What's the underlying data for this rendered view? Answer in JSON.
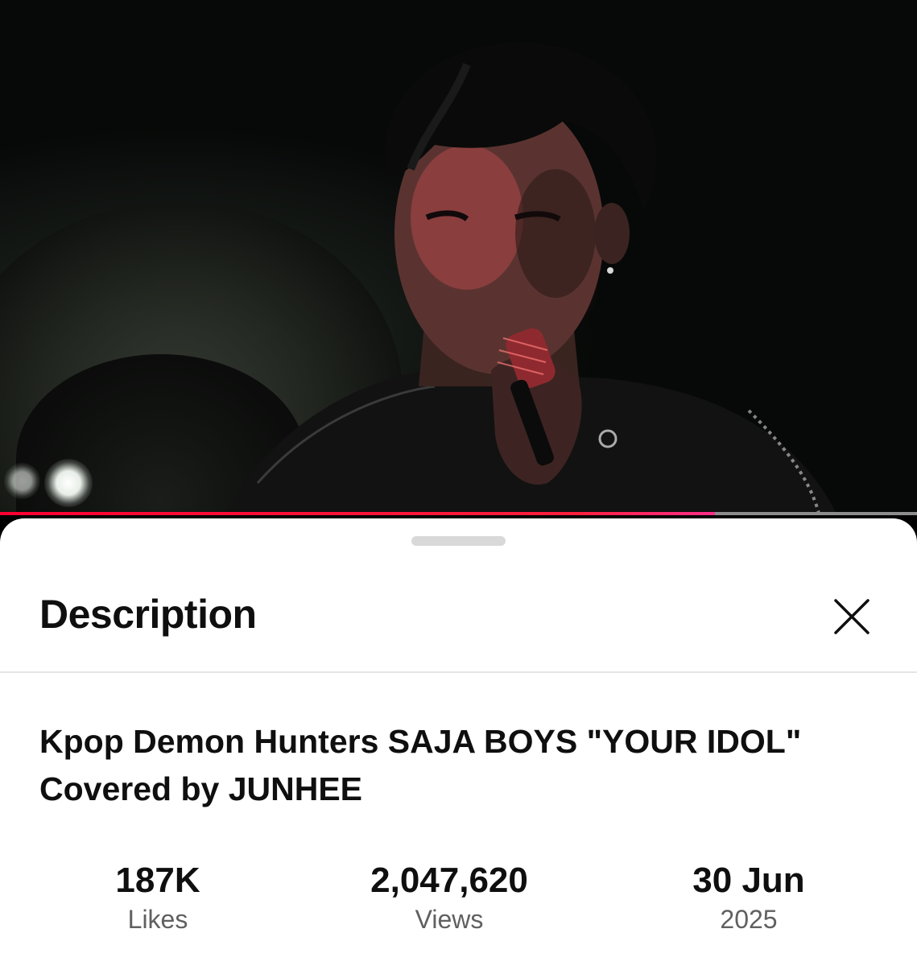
{
  "video": {
    "progress_fraction": 0.78,
    "progress_color": "#ff0033"
  },
  "sheet": {
    "title": "Description",
    "close_icon": "close-icon"
  },
  "description": {
    "video_title": "Kpop Demon Hunters SAJA BOYS \"YOUR IDOL\"  Covered by JUNHEE",
    "stats": [
      {
        "value": "187K",
        "label": "Likes"
      },
      {
        "value": "2,047,620",
        "label": "Views"
      },
      {
        "value": "30 Jun",
        "label": "2025"
      }
    ]
  }
}
